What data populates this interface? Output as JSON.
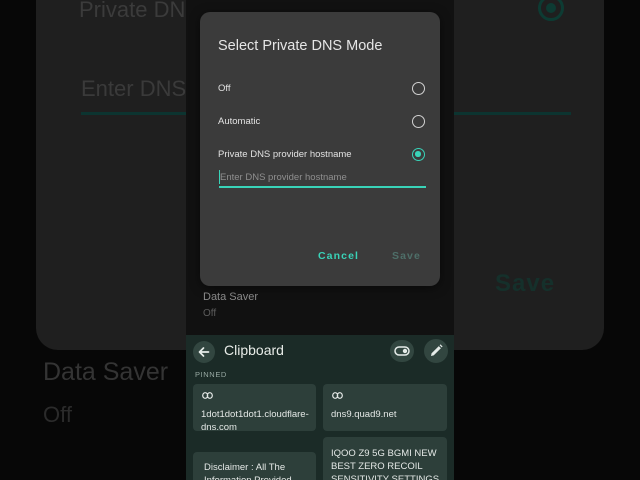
{
  "background": {
    "title": "Private DNS",
    "input_placeholder": "Enter DNS",
    "save_label": "Save",
    "data_saver_title": "Data Saver",
    "data_saver_value": "Off"
  },
  "screen": {
    "data_saver_title": "Data Saver",
    "data_saver_value": "Off"
  },
  "dialog": {
    "title": "Select Private DNS Mode",
    "options": [
      {
        "label": "Off",
        "selected": false
      },
      {
        "label": "Automatic",
        "selected": false
      },
      {
        "label": "Private DNS provider hostname",
        "selected": true
      }
    ],
    "input_value": "",
    "input_placeholder": "Enter DNS provider hostname",
    "cancel_label": "Cancel",
    "save_label": "Save"
  },
  "clipboard": {
    "title": "Clipboard",
    "section_label": "PINNED",
    "items": [
      {
        "text": "1dot1dot1dot1.cloudflare-dns.com",
        "icon": "link-icon"
      },
      {
        "text": "dns9.quad9.net",
        "icon": "link-icon"
      },
      {
        "text": "Disclaimer : All The Information Provided",
        "icon": ""
      },
      {
        "text": "IQOO Z9 5G BGMI NEW BEST ZERO RECOIL SENSITIVITY SETTINGS",
        "icon": ""
      }
    ]
  },
  "colors": {
    "accent": "#39d3b8",
    "dialog_bg": "#3b3b3b",
    "clipboard_bg": "#1b2b27",
    "chip_bg": "#2d3f3a"
  }
}
